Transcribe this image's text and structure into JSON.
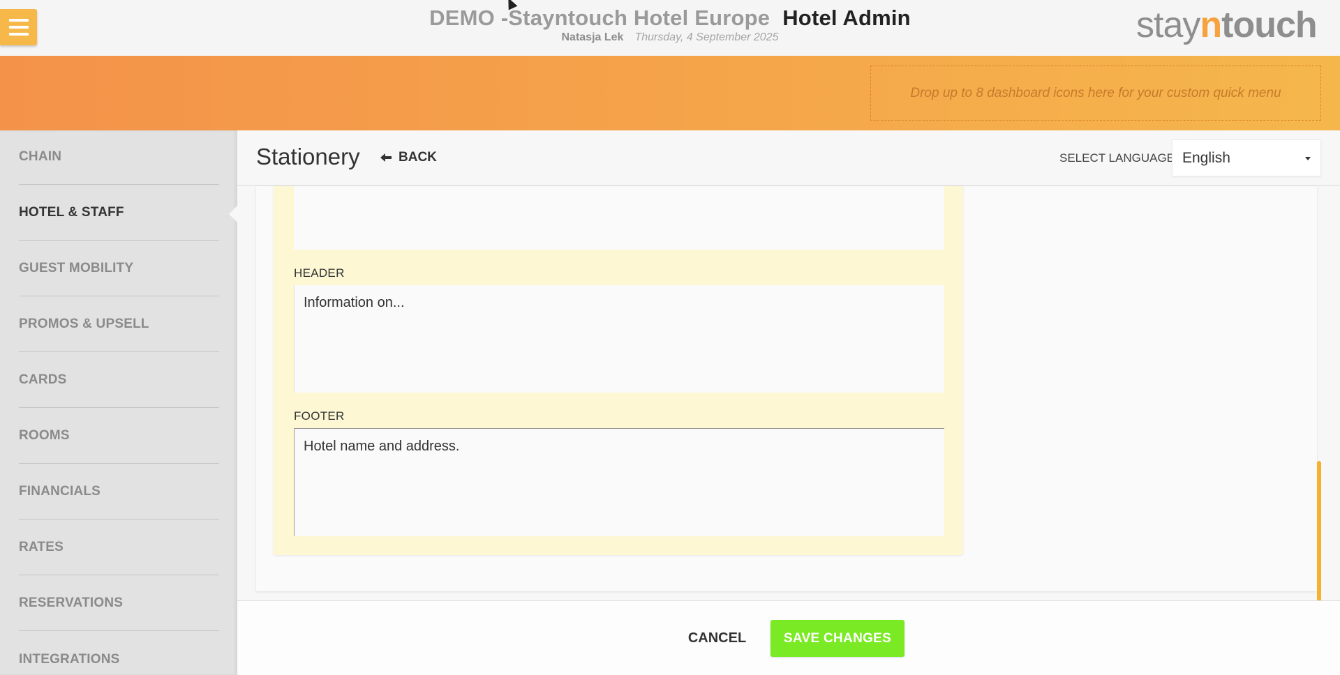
{
  "header": {
    "hotel_name": "DEMO -Stayntouch Hotel Europe",
    "app_name": "Hotel Admin",
    "user": "Natasja Lek",
    "date": "Thursday, 4 September 2025",
    "logo": {
      "part1": "stay",
      "part2": "n",
      "part3": "touch"
    }
  },
  "banner": {
    "quick_menu_hint": "Drop up to 8 dashboard icons here for your custom quick menu"
  },
  "sidebar": {
    "items": [
      {
        "label": "CHAIN"
      },
      {
        "label": "HOTEL & STAFF"
      },
      {
        "label": "GUEST MOBILITY"
      },
      {
        "label": "PROMOS & UPSELL"
      },
      {
        "label": "CARDS"
      },
      {
        "label": "ROOMS"
      },
      {
        "label": "FINANCIALS"
      },
      {
        "label": "RATES"
      },
      {
        "label": "RESERVATIONS"
      },
      {
        "label": "INTEGRATIONS"
      }
    ]
  },
  "page": {
    "title": "Stationery",
    "back_label": "BACK",
    "language_label": "SELECT LANGUAGE",
    "language_value": "English"
  },
  "form": {
    "header_label": "HEADER",
    "header_value": "Information on...",
    "footer_label": "FOOTER",
    "footer_value": "Hotel name and address."
  },
  "actions": {
    "cancel_label": "CANCEL",
    "save_label": "SAVE CHANGES"
  },
  "colors": {
    "accent": "#f7b84a",
    "save_green": "#7aea24",
    "panel_yellow": "#fdf7d4"
  }
}
